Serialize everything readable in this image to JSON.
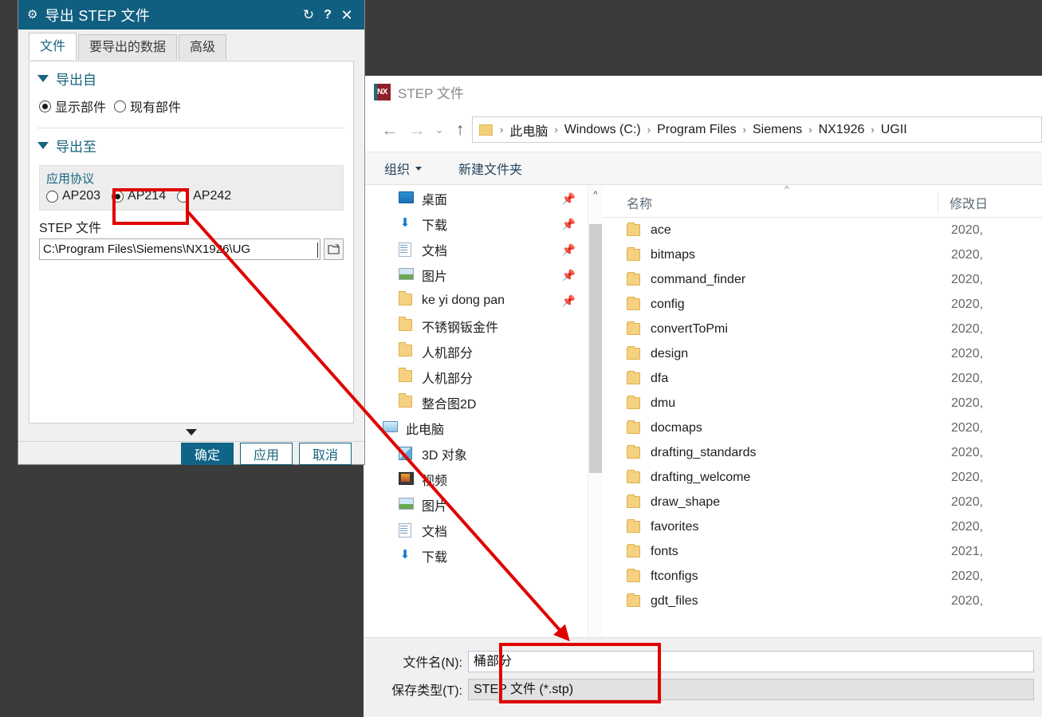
{
  "nx_dialog": {
    "title": "导出 STEP 文件",
    "title_icons": {
      "gear": "gear-icon",
      "reset": "↻",
      "help": "?",
      "close": "✕"
    },
    "tabs": [
      {
        "label": "文件",
        "active": true
      },
      {
        "label": "要导出的数据",
        "active": false
      },
      {
        "label": "高级",
        "active": false
      }
    ],
    "export_from": {
      "section_title": "导出自",
      "options": [
        {
          "label": "显示部件",
          "selected": true
        },
        {
          "label": "现有部件",
          "selected": false
        }
      ]
    },
    "export_to": {
      "section_title": "导出至",
      "group_label": "应用协议",
      "protocols": [
        {
          "label": "AP203",
          "selected": false
        },
        {
          "label": "AP214",
          "selected": true
        },
        {
          "label": "AP242",
          "selected": false
        }
      ],
      "file_field_label": "STEP 文件",
      "file_path": "C:\\Program Files\\Siemens\\NX1926\\UG",
      "browse_icon": "folder-open-icon"
    },
    "buttons": [
      {
        "label": "确定",
        "primary": true
      },
      {
        "label": "应用",
        "primary": false
      },
      {
        "label": "取消",
        "primary": false
      }
    ]
  },
  "explorer": {
    "window_title": "STEP 文件",
    "logo_text": "NX",
    "nav_buttons": {
      "back": "←",
      "forward": "→",
      "recent": "⌄",
      "up": "↑"
    },
    "breadcrumb": [
      "此电脑",
      "Windows (C:)",
      "Program Files",
      "Siemens",
      "NX1926",
      "UGII"
    ],
    "toolbar": [
      {
        "label": "组织",
        "has_caret": true
      },
      {
        "label": "新建文件夹",
        "has_caret": false
      }
    ],
    "nav_pane": [
      {
        "label": "桌面",
        "icon": "desktop-icon",
        "pinned": true,
        "level": 1
      },
      {
        "label": "下载",
        "icon": "download-icon",
        "pinned": true,
        "level": 1
      },
      {
        "label": "文档",
        "icon": "documents-icon",
        "pinned": true,
        "level": 1
      },
      {
        "label": "图片",
        "icon": "pictures-icon",
        "pinned": true,
        "level": 1
      },
      {
        "label": "ke yi dong pan",
        "icon": "folder-icon",
        "pinned": true,
        "level": 1
      },
      {
        "label": "不锈钢钣金件",
        "icon": "folder-icon",
        "pinned": false,
        "level": 1
      },
      {
        "label": "人机部分",
        "icon": "folder-icon",
        "pinned": false,
        "level": 1
      },
      {
        "label": "人机部分",
        "icon": "folder-icon",
        "pinned": false,
        "level": 1
      },
      {
        "label": "整合图2D",
        "icon": "folder-icon",
        "pinned": false,
        "level": 1
      },
      {
        "label": "此电脑",
        "icon": "this-pc-icon",
        "pinned": false,
        "level": 0
      },
      {
        "label": "3D 对象",
        "icon": "3d-objects-icon",
        "pinned": false,
        "level": 1
      },
      {
        "label": "视频",
        "icon": "videos-icon",
        "pinned": false,
        "level": 1
      },
      {
        "label": "图片",
        "icon": "pictures-icon",
        "pinned": false,
        "level": 1
      },
      {
        "label": "文档",
        "icon": "documents-icon",
        "pinned": false,
        "level": 1
      },
      {
        "label": "下载",
        "icon": "download-icon",
        "pinned": false,
        "level": 1
      }
    ],
    "columns": {
      "name": "名称",
      "modified": "修改日"
    },
    "files": [
      {
        "name": "ace",
        "modified": "2020,"
      },
      {
        "name": "bitmaps",
        "modified": "2020,"
      },
      {
        "name": "command_finder",
        "modified": "2020,"
      },
      {
        "name": "config",
        "modified": "2020,"
      },
      {
        "name": "convertToPmi",
        "modified": "2020,"
      },
      {
        "name": "design",
        "modified": "2020,"
      },
      {
        "name": "dfa",
        "modified": "2020,"
      },
      {
        "name": "dmu",
        "modified": "2020,"
      },
      {
        "name": "docmaps",
        "modified": "2020,"
      },
      {
        "name": "drafting_standards",
        "modified": "2020,"
      },
      {
        "name": "drafting_welcome",
        "modified": "2020,"
      },
      {
        "name": "draw_shape",
        "modified": "2020,"
      },
      {
        "name": "favorites",
        "modified": "2020,"
      },
      {
        "name": "fonts",
        "modified": "2021,"
      },
      {
        "name": "ftconfigs",
        "modified": "2020,"
      },
      {
        "name": "gdt_files",
        "modified": "2020,"
      }
    ],
    "save_form": {
      "filename_label": "文件名(N):",
      "filename_value": "桶部分",
      "filetype_label": "保存类型(T):",
      "filetype_value": "STEP 文件 (*.stp)"
    }
  },
  "annotations": {
    "highlight_color": "#e00000",
    "boxes": [
      {
        "name": "ap214-highlight"
      },
      {
        "name": "filename-highlight"
      }
    ],
    "arrow": {
      "name": "pointer-arrow"
    }
  }
}
